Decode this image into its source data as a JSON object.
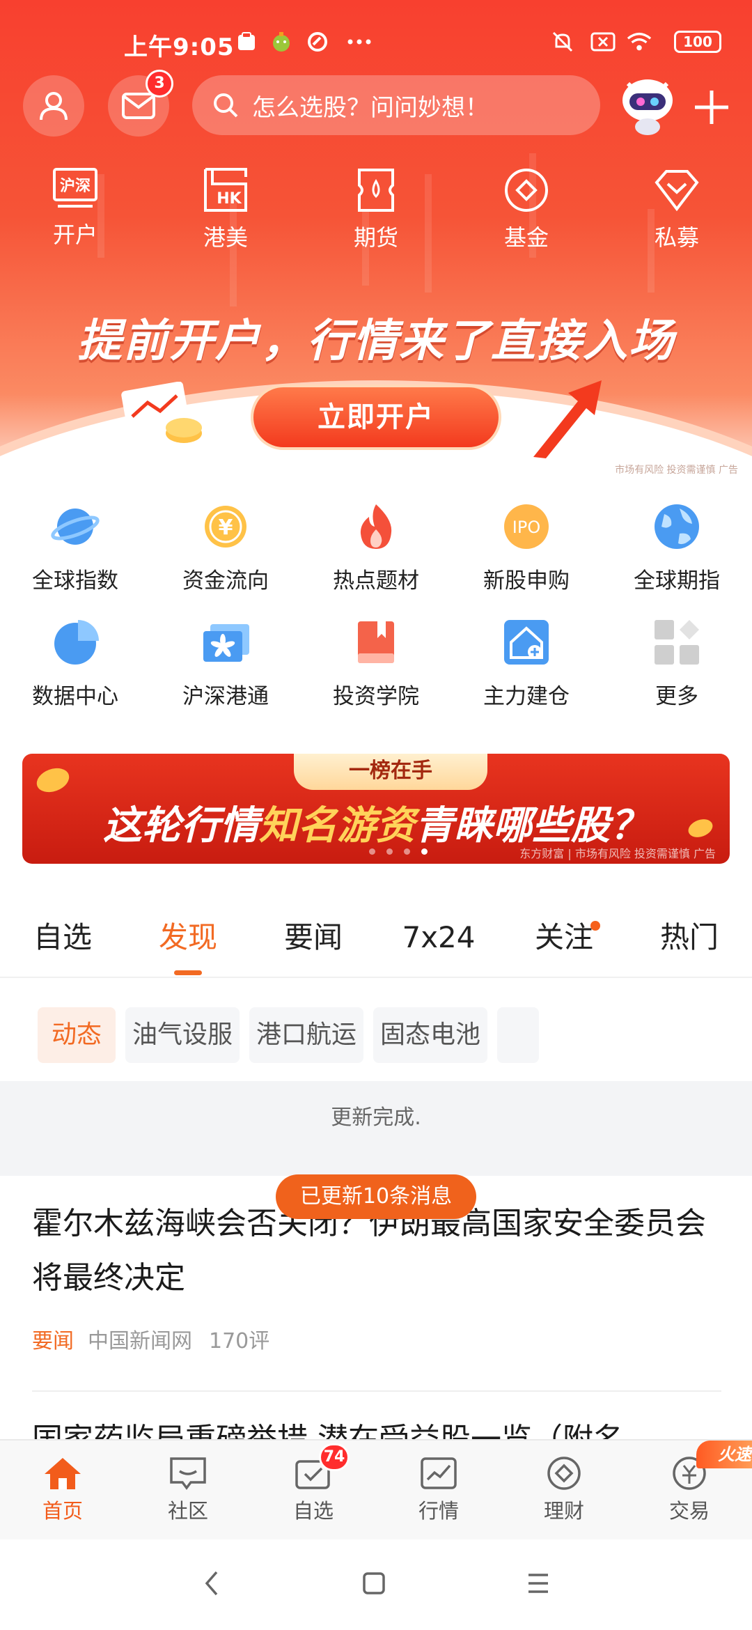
{
  "status_bar": {
    "time": "上午9:05",
    "battery": "100"
  },
  "header": {
    "mail_badge": "3",
    "search_placeholder": "怎么选股？问问妙想！"
  },
  "quick_entries": [
    {
      "label": "开户",
      "icon_text": "沪深"
    },
    {
      "label": "港美",
      "icon_text": "HK"
    },
    {
      "label": "期货"
    },
    {
      "label": "基金"
    },
    {
      "label": "私募"
    }
  ],
  "hero_banner": {
    "title": "提前开户，行情来了直接入场",
    "cta": "立即开户",
    "disclaimer": "市场有风险 投资需谨慎 广告"
  },
  "feature_grid": [
    [
      {
        "label": "全球指数",
        "icon": "planet-icon"
      },
      {
        "label": "资金流向",
        "icon": "yuan-coin-icon"
      },
      {
        "label": "热点题材",
        "icon": "flame-icon"
      },
      {
        "label": "新股申购",
        "icon": "ipo-icon",
        "icon_text": "IPO"
      },
      {
        "label": "全球期指",
        "icon": "globe-icon"
      }
    ],
    [
      {
        "label": "数据中心",
        "icon": "pie-chart-icon"
      },
      {
        "label": "沪深港通",
        "icon": "hk-flag-icon"
      },
      {
        "label": "投资学院",
        "icon": "book-icon"
      },
      {
        "label": "主力建仓",
        "icon": "house-plus-icon"
      },
      {
        "label": "更多",
        "icon": "grid-more-icon"
      }
    ]
  ],
  "promo_banner": {
    "tag": "一榜在手",
    "headline_pre": "这轮行情",
    "headline_highlight": "知名游资",
    "headline_post": "青睐哪些股？",
    "footer": "东方财富 | 市场有风险 投资需谨慎 广告",
    "active_dot": 3,
    "dot_count": 4
  },
  "content_tabs": [
    {
      "label": "自选"
    },
    {
      "label": "发现",
      "active": true
    },
    {
      "label": "要闻"
    },
    {
      "label": "7x24"
    },
    {
      "label": "关注",
      "dot": true
    },
    {
      "label": "热门"
    }
  ],
  "chips": [
    {
      "label": "动态",
      "active": true
    },
    {
      "label": "油气设服"
    },
    {
      "label": "港口航运"
    },
    {
      "label": "固态电池"
    }
  ],
  "feed": {
    "update_text": "更新完成.",
    "toast": "已更新10条消息",
    "articles": [
      {
        "title": "霍尔木兹海峡会否关闭？伊朗最高国家安全委员会将最终决定",
        "tag": "要闻",
        "source": "中国新闻网",
        "comments": "170评"
      },
      {
        "title": "国家药监局重磅举措 潜在受益股一览（附名"
      }
    ]
  },
  "bottom_nav": [
    {
      "label": "首页",
      "active": true
    },
    {
      "label": "社区"
    },
    {
      "label": "自选",
      "badge": "74"
    },
    {
      "label": "行情"
    },
    {
      "label": "理财"
    },
    {
      "label": "交易",
      "hot": "火速"
    }
  ],
  "colors": {
    "accent": "#f26a23",
    "hero_red": "#f8402f",
    "badge_red": "#ff2d2d"
  }
}
